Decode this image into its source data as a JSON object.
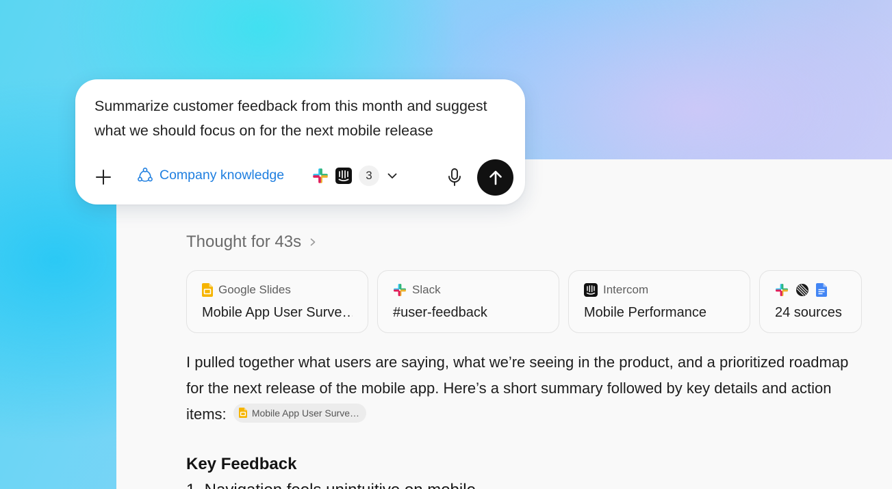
{
  "prompt": {
    "text": "Summarize customer feedback from this month and suggest what we should focus on for the next mobile release",
    "company_knowledge_label": "Company knowledge",
    "connector_count": "3",
    "accent_color": "#1f7fe0"
  },
  "thought": {
    "label": "Thought for 43s"
  },
  "sources": [
    {
      "app": "Google Slides",
      "title": "Mobile App User Surve…",
      "icon": "google-slides-icon"
    },
    {
      "app": "Slack",
      "title": "#user-feedback",
      "icon": "slack-icon"
    },
    {
      "app": "Intercom",
      "title": "Mobile Performance",
      "icon": "intercom-icon"
    },
    {
      "title": "24 sources",
      "icons": [
        "slack-icon",
        "linear-icon",
        "google-docs-icon"
      ]
    }
  ],
  "answer": {
    "text": "I pulled together what users are saying, what we’re seeing in the product, and a prioritized roadmap for the next release of the mobile app. Here’s a short summary followed by key details and action items:",
    "citation_chip": "Mobile App User Surve…"
  },
  "section": {
    "title": "Key Feedback",
    "first_item_partial": "1. Navigation feels unintuitive on mobile"
  }
}
